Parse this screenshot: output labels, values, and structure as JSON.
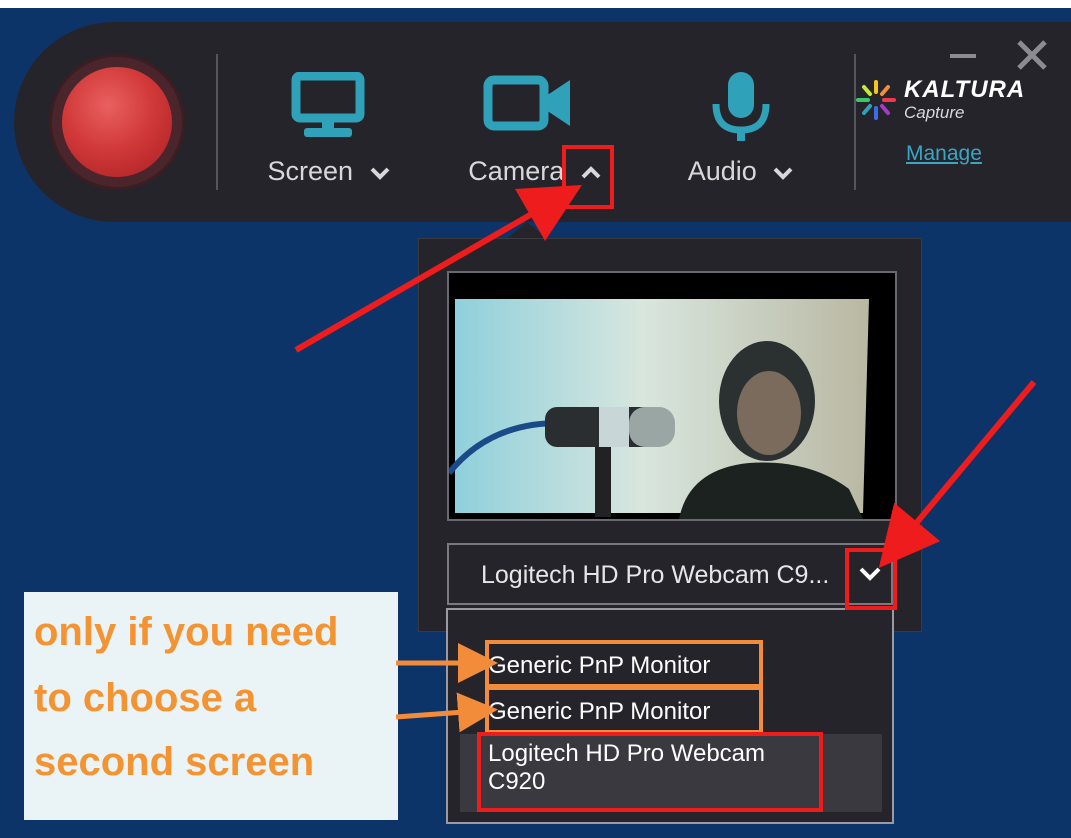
{
  "toolbar": {
    "screen_label": "Screen",
    "camera_label": "Camera",
    "audio_label": "Audio",
    "brand_name": "KALTURA",
    "brand_sub": "Capture",
    "manage_link": "Manage"
  },
  "camera_panel": {
    "selected_device": "Logitech HD Pro Webcam C9...",
    "options": [
      {
        "label": "Generic PnP Monitor"
      },
      {
        "label": "Generic PnP Monitor"
      },
      {
        "label_line1": "Logitech HD Pro Webcam",
        "label_line2": "C920"
      }
    ]
  },
  "annotation": {
    "line1": "only if you need",
    "line2": "to choose a",
    "line3": "second screen"
  },
  "colors": {
    "background": "#0d3469",
    "panel": "#25242b",
    "accent": "#2fa1b8",
    "record": "#d23a3a",
    "annotation_red": "#ee1c1c",
    "annotation_orange": "#f28c3a"
  }
}
